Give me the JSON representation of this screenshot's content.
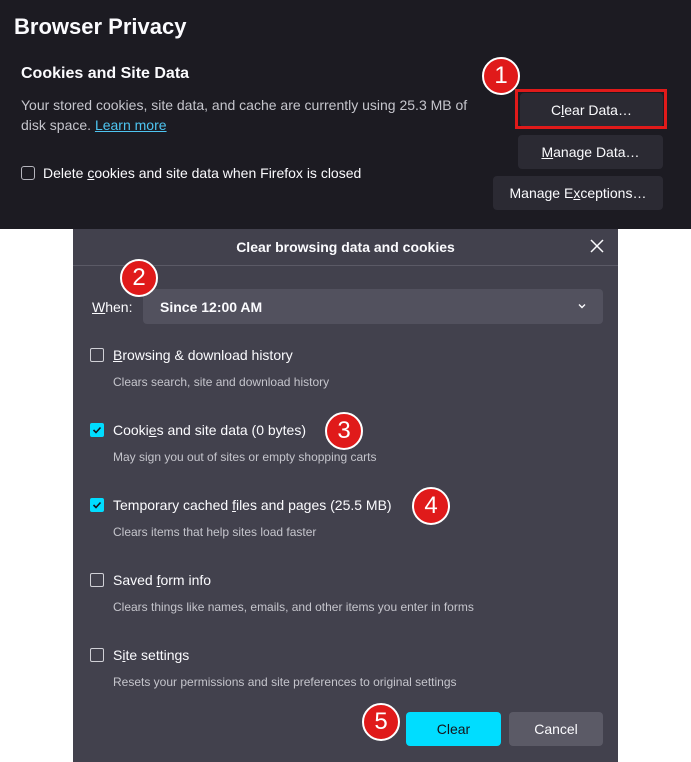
{
  "colors": {
    "panel_bg": "#1c1b22",
    "dialog_bg": "#42414d",
    "accent": "#00ddff",
    "highlight": "#e01a1a",
    "link": "#4ec5f1"
  },
  "privacy_panel": {
    "title": "Browser Privacy",
    "section_title": "Cookies and Site Data",
    "description": "Your stored cookies, site data, and cache are currently using 25.3 MB of disk space.",
    "learn_more": "Learn more",
    "delete_on_close": {
      "pre": "Delete ",
      "u": "c",
      "post": "ookies and site data when Firefox is closed",
      "checked": false
    },
    "buttons": {
      "clear_data": {
        "pre": "C",
        "u": "l",
        "post": "ear Data…"
      },
      "manage_data": {
        "pre": "",
        "u": "M",
        "post": "anage Data…"
      },
      "manage_exceptions": {
        "pre": "Manage E",
        "u": "x",
        "post": "ceptions…"
      }
    }
  },
  "dialog": {
    "title": "Clear browsing data and cookies",
    "close_icon": "close-icon",
    "when": {
      "label_u": "W",
      "label_post": "hen:",
      "selected": "Since 12:00 AM"
    },
    "options": [
      {
        "pre": "",
        "u": "B",
        "post": "rowsing & download history",
        "desc": "Clears search, site and download history",
        "checked": false
      },
      {
        "pre": "Cooki",
        "u": "e",
        "post": "s and site data (0 bytes)",
        "desc": "May sign you out of sites or empty shopping carts",
        "checked": true
      },
      {
        "pre": "Temporary cached ",
        "u": "f",
        "post": "iles and pages (25.5 MB)",
        "desc": "Clears items that help sites load faster",
        "checked": true
      },
      {
        "pre": "Saved ",
        "u": "f",
        "post": "orm info",
        "desc": "Clears things like names, emails, and other items you enter in forms",
        "checked": false
      },
      {
        "pre": "S",
        "u": "i",
        "post": "te settings",
        "desc": "Resets your permissions and site preferences to original settings",
        "checked": false
      }
    ],
    "clear_button": "Clear",
    "cancel_button": "Cancel"
  },
  "badges": [
    "1",
    "2",
    "3",
    "4",
    "5"
  ]
}
